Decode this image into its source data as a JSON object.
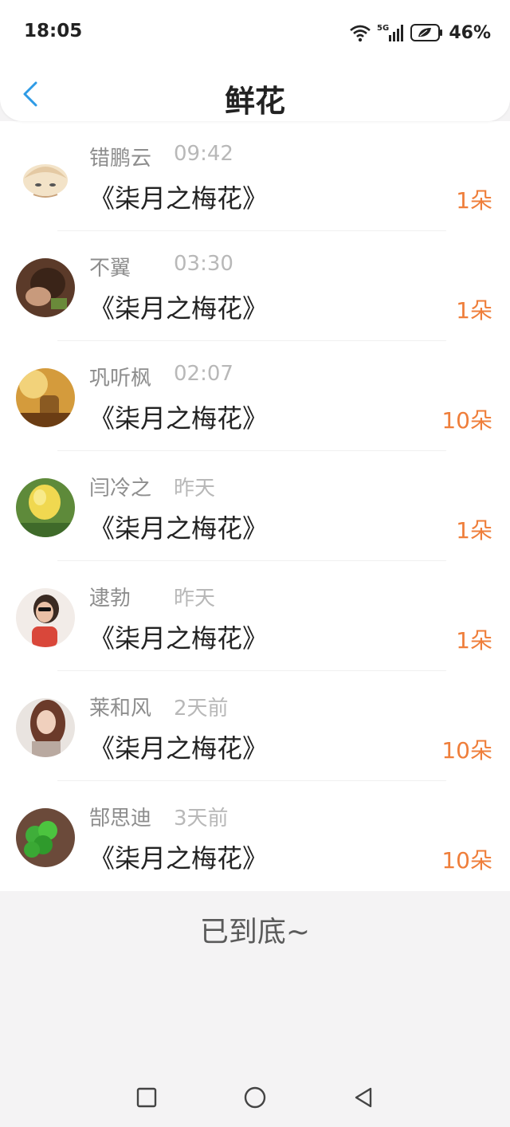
{
  "status_bar": {
    "time": "18:05",
    "network": "5G",
    "battery": "46%"
  },
  "header": {
    "title": "鲜花"
  },
  "rows": [
    {
      "name": "错鹏云",
      "time": "09:42",
      "book": "《柒月之梅花》",
      "count": "1朵"
    },
    {
      "name": "不翼",
      "time": "03:30",
      "book": "《柒月之梅花》",
      "count": "1朵"
    },
    {
      "name": "巩听枫",
      "time": "02:07",
      "book": "《柒月之梅花》",
      "count": "10朵"
    },
    {
      "name": "闫冷之",
      "time": "昨天",
      "book": "《柒月之梅花》",
      "count": "1朵"
    },
    {
      "name": "逮勃",
      "time": "昨天",
      "book": "《柒月之梅花》",
      "count": "1朵"
    },
    {
      "name": "莱和风",
      "time": "2天前",
      "book": "《柒月之梅花》",
      "count": "10朵"
    },
    {
      "name": "郜思迪",
      "time": "3天前",
      "book": "《柒月之梅花》",
      "count": "10朵"
    }
  ],
  "footer": {
    "end_text": "已到底~"
  },
  "colors": {
    "accent": "#ef7e3a",
    "back": "#2e9be6"
  }
}
